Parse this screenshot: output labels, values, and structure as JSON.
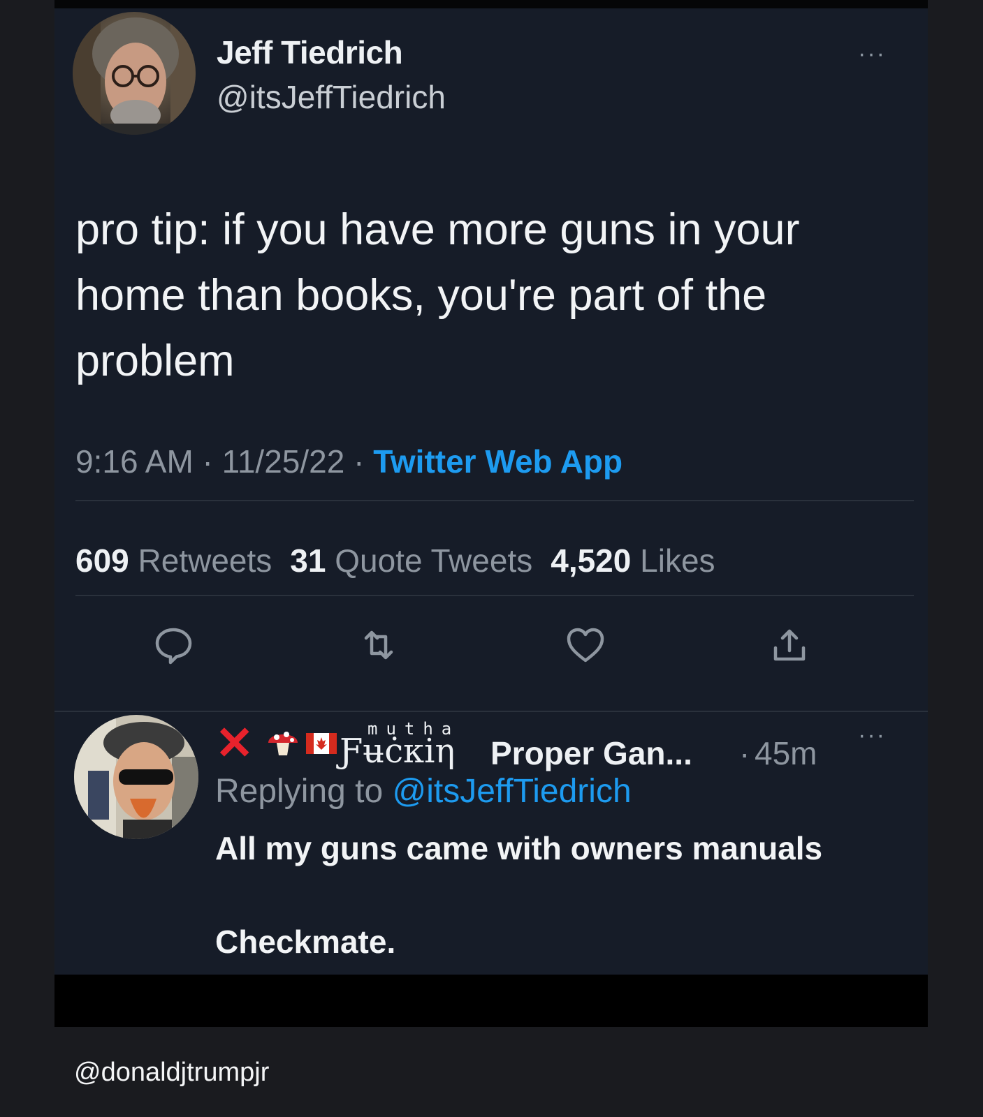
{
  "tweet": {
    "author_name": "Jeff Tiedrich",
    "author_handle": "@itsJeffTiedrich",
    "more": "···",
    "text": "pro tip: if you have more guns in your home than books, you're part of the problem",
    "time": "9:16 AM",
    "date": "11/25/22",
    "separator": " · ",
    "source": "Twitter Web App",
    "stats": {
      "retweets_count": "609",
      "retweets_label": "Retweets",
      "quotes_count": "31",
      "quotes_label": "Quote Tweets",
      "likes_count": "4,520",
      "likes_label": "Likes"
    },
    "actions": [
      "reply-icon",
      "retweet-icon",
      "like-icon",
      "share-icon"
    ]
  },
  "reply": {
    "name_x": "✕",
    "name_sup": "mutha",
    "name_fancy": "Ƒʉċкiη",
    "name_rest": "Proper Gan...",
    "dot": "·",
    "time": "45m",
    "more": "···",
    "replying_label": "Replying to",
    "replying_handle": "@itsJeffTiedrich",
    "text_line1": "All my guns came with owners manuals",
    "text_line2": "Checkmate."
  },
  "credit": "@donaldjtrumpjr",
  "colors": {
    "background": "#1a1b1f",
    "card": "#161c28",
    "link": "#1d9bf0",
    "muted": "#8e96a0",
    "text": "#f2f4f6",
    "red_x": "#e8222c"
  }
}
